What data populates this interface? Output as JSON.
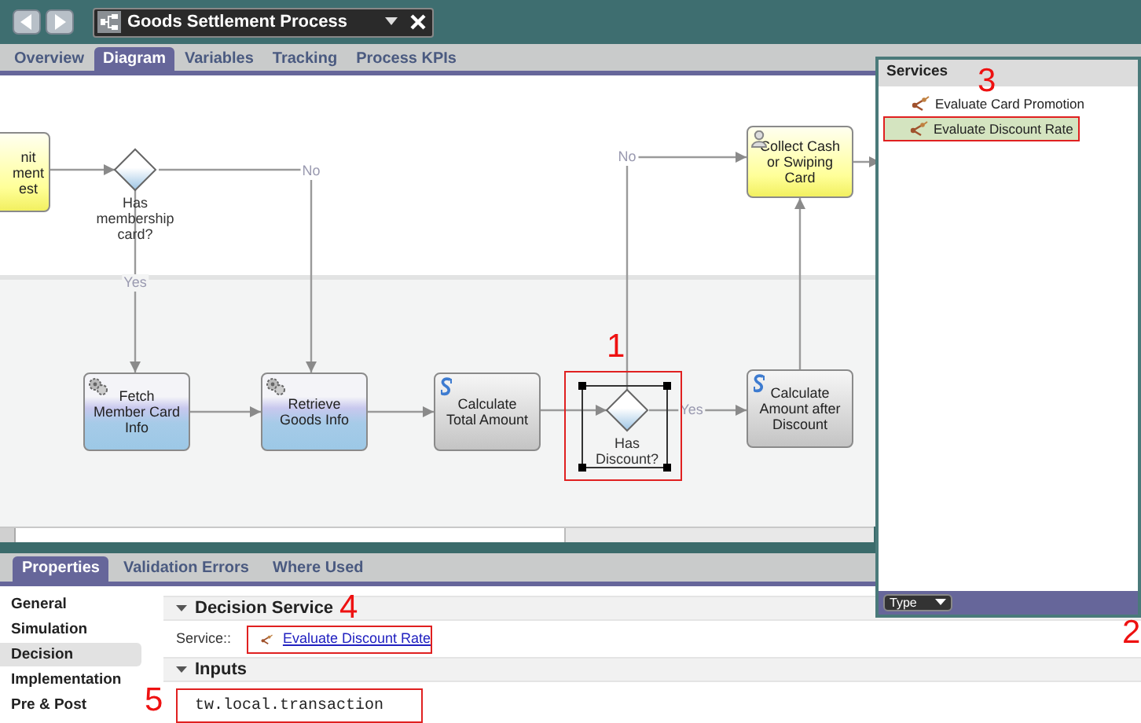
{
  "window": {
    "title": "Goods Settlement Process"
  },
  "editor_tabs": [
    {
      "label": "Overview",
      "selected": false
    },
    {
      "label": "Diagram",
      "selected": true
    },
    {
      "label": "Variables",
      "selected": false
    },
    {
      "label": "Tracking",
      "selected": false
    },
    {
      "label": "Process KPIs",
      "selected": false
    }
  ],
  "diagram": {
    "nodes": [
      {
        "kind": "user_task",
        "lines": [
          "nit",
          "ment",
          "est"
        ],
        "selected": false
      },
      {
        "kind": "gateway",
        "lines": [
          "Has",
          "membership",
          "card?"
        ],
        "selected": false
      },
      {
        "kind": "user_task",
        "lines": [
          "Collect Cash",
          "or Swiping",
          "Card"
        ],
        "selected": false
      },
      {
        "kind": "system_task",
        "lines": [
          "Fetch",
          "Member Card",
          "Info"
        ],
        "selected": false
      },
      {
        "kind": "system_task",
        "lines": [
          "Retrieve",
          "Goods Info"
        ],
        "selected": false
      },
      {
        "kind": "script_task",
        "lines": [
          "Calculate",
          "Total Amount"
        ],
        "selected": false
      },
      {
        "kind": "gateway",
        "lines": [
          "Has",
          "Discount?"
        ],
        "selected": true
      },
      {
        "kind": "script_task",
        "lines": [
          "Calculate",
          "Amount after",
          "Discount"
        ],
        "selected": false
      }
    ],
    "edge_labels": [
      "No",
      "Yes",
      "No",
      "Yes"
    ]
  },
  "services_panel": {
    "title": "Services",
    "items": [
      {
        "label": "Evaluate Card Promotion",
        "selected": false
      },
      {
        "label": "Evaluate Discount Rate",
        "selected": true
      }
    ],
    "filter": "Type"
  },
  "properties": {
    "tabs": [
      {
        "label": "Properties",
        "selected": true
      },
      {
        "label": "Validation Errors",
        "selected": false
      },
      {
        "label": "Where Used",
        "selected": false
      }
    ],
    "nav": [
      {
        "label": "General",
        "selected": false
      },
      {
        "label": "Simulation",
        "selected": false
      },
      {
        "label": "Decision",
        "selected": true
      },
      {
        "label": "Implementation",
        "selected": false
      },
      {
        "label": "Pre & Post",
        "selected": false
      }
    ],
    "sections": [
      {
        "title": "Decision Service",
        "expanded": true
      },
      {
        "title": "Inputs",
        "expanded": true
      }
    ],
    "service_label": "Service::",
    "service_link": "Evaluate Discount Rate",
    "input_value": "tw.local.transaction"
  },
  "annotations": [
    "1",
    "2",
    "3",
    "4",
    "5"
  ]
}
